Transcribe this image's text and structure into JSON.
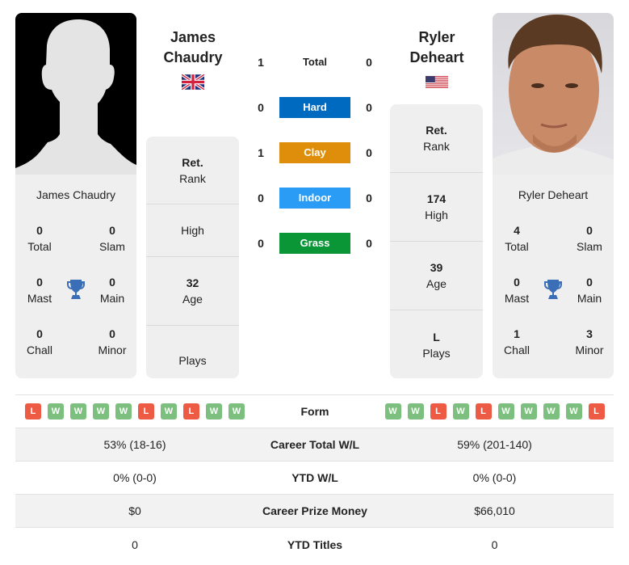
{
  "colors": {
    "hard": "#0069c0",
    "clay": "#de8e0a",
    "indoor": "#2a9cf6",
    "grass": "#0a9537",
    "win": "#7dbf7e",
    "loss": "#ee5b45",
    "trophy": "#3a6fb8"
  },
  "player1": {
    "name_line1": "James",
    "name_line2": "Chaudry",
    "full_name": "James Chaudry",
    "flag": "uk-flag",
    "photo": "silhouette-placeholder",
    "titles": {
      "total": {
        "value": "0",
        "label": "Total"
      },
      "slam": {
        "value": "0",
        "label": "Slam"
      },
      "mast": {
        "value": "0",
        "label": "Mast"
      },
      "main": {
        "value": "0",
        "label": "Main"
      },
      "chall": {
        "value": "0",
        "label": "Chall"
      },
      "minor": {
        "value": "0",
        "label": "Minor"
      }
    },
    "info": {
      "rank": {
        "value": "Ret.",
        "label": "Rank"
      },
      "high": {
        "value": "",
        "label": "High"
      },
      "age": {
        "value": "32",
        "label": "Age"
      },
      "plays": {
        "value": "",
        "label": "Plays"
      }
    },
    "form": [
      "L",
      "W",
      "W",
      "W",
      "W",
      "L",
      "W",
      "L",
      "W",
      "W"
    ],
    "career_wl": "53% (18-16)",
    "ytd_wl": "0% (0-0)",
    "prize_money": "$0",
    "ytd_titles": "0"
  },
  "player2": {
    "name_line1": "Ryler",
    "name_line2": "Deheart",
    "full_name": "Ryler Deheart",
    "flag": "us-flag",
    "photo": "player-portrait",
    "titles": {
      "total": {
        "value": "4",
        "label": "Total"
      },
      "slam": {
        "value": "0",
        "label": "Slam"
      },
      "mast": {
        "value": "0",
        "label": "Mast"
      },
      "main": {
        "value": "0",
        "label": "Main"
      },
      "chall": {
        "value": "1",
        "label": "Chall"
      },
      "minor": {
        "value": "3",
        "label": "Minor"
      }
    },
    "info": {
      "rank": {
        "value": "Ret.",
        "label": "Rank"
      },
      "high": {
        "value": "174",
        "label": "High"
      },
      "age": {
        "value": "39",
        "label": "Age"
      },
      "plays": {
        "value": "L",
        "label": "Plays"
      }
    },
    "form": [
      "W",
      "W",
      "L",
      "W",
      "L",
      "W",
      "W",
      "W",
      "W",
      "L"
    ],
    "career_wl": "59% (201-140)",
    "ytd_wl": "0% (0-0)",
    "prize_money": "$66,010",
    "ytd_titles": "0"
  },
  "h2h": [
    {
      "label": "Total",
      "p1": "1",
      "p2": "0",
      "surface": "total"
    },
    {
      "label": "Hard",
      "p1": "0",
      "p2": "0",
      "surface": "hard"
    },
    {
      "label": "Clay",
      "p1": "1",
      "p2": "0",
      "surface": "clay"
    },
    {
      "label": "Indoor",
      "p1": "0",
      "p2": "0",
      "surface": "indoor"
    },
    {
      "label": "Grass",
      "p1": "0",
      "p2": "0",
      "surface": "grass"
    }
  ],
  "stats_labels": {
    "form": "Form",
    "career_wl": "Career Total W/L",
    "ytd_wl": "YTD W/L",
    "prize_money": "Career Prize Money",
    "ytd_titles": "YTD Titles"
  }
}
